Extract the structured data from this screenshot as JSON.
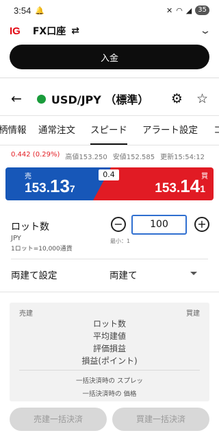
{
  "status": {
    "time": "3:54",
    "battery": "35"
  },
  "app": {
    "logo": "IG",
    "account": "FX口座",
    "swap_icon": "⇄"
  },
  "deposit_label": "入金",
  "instrument": {
    "name": "USD/JPY （標準）",
    "status_color": "#1a9c3b"
  },
  "tabs": [
    {
      "label": "柄情報"
    },
    {
      "label": "通常注文"
    },
    {
      "label": "スピード",
      "active": true
    },
    {
      "label": "アラート設定"
    },
    {
      "label": "コ"
    }
  ],
  "stats": {
    "change": "0.442 (0.29%)",
    "high_label": "高値",
    "high": "153.250",
    "low_label": "安値",
    "low": "152.585",
    "updated_label": "更新",
    "updated": "15:54:12"
  },
  "prices": {
    "sell_label": "売",
    "buy_label": "買",
    "spread": "0.4",
    "sell": {
      "prefix": "153.",
      "big": "13",
      "suffix": "7"
    },
    "buy": {
      "prefix": "153.",
      "big": "14",
      "suffix": "1"
    }
  },
  "lot": {
    "label": "ロット数",
    "currency": "JPY",
    "unit": "1ロット=10,000通貨",
    "value": "100",
    "minimum": "最小：1"
  },
  "hedge": {
    "label": "両建て設定",
    "value": "両建て"
  },
  "summary": {
    "sell_header": "売建",
    "buy_header": "買建",
    "rows": [
      "ロット数",
      "平均建値",
      "評価損益",
      "損益(ポイント)"
    ],
    "spread_note": "一括決済時の スプレッ",
    "price_note": "一括決済時の 価格"
  },
  "bulk": {
    "sell": "売建一括決済",
    "buy": "買建一括決済"
  },
  "colors": {
    "sell": "#1757b8",
    "buy": "#e11b24",
    "accent": "#2f6fd0"
  }
}
